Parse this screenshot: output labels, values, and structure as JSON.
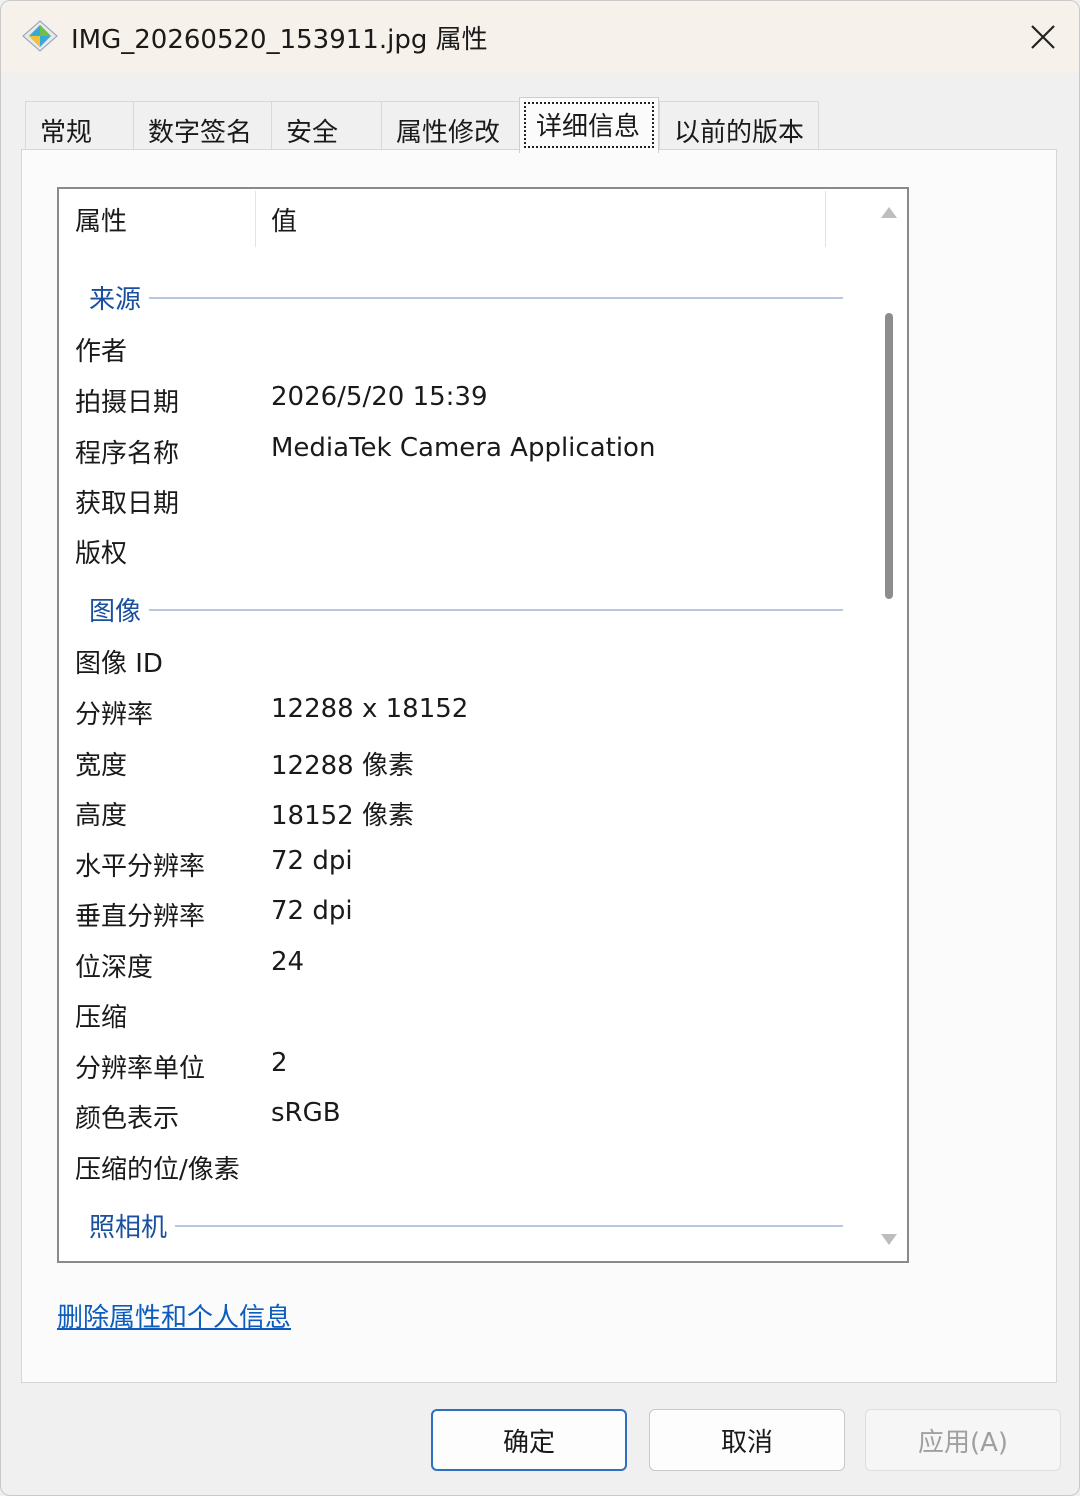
{
  "window": {
    "title": "IMG_20260520_153911.jpg 属性"
  },
  "tabs": [
    {
      "label": "常规"
    },
    {
      "label": "数字签名"
    },
    {
      "label": "安全"
    },
    {
      "label": "属性修改"
    },
    {
      "label": "详细信息"
    },
    {
      "label": "以前的版本"
    }
  ],
  "active_tab": "详细信息",
  "list": {
    "header": {
      "property": "属性",
      "value": "值"
    },
    "groups": {
      "source": {
        "label": "来源",
        "rows": [
          {
            "k": "作者",
            "v": ""
          },
          {
            "k": "拍摄日期",
            "v": "2026/5/20 15:39"
          },
          {
            "k": "程序名称",
            "v": "MediaTek Camera Application"
          },
          {
            "k": "获取日期",
            "v": ""
          },
          {
            "k": "版权",
            "v": ""
          }
        ]
      },
      "image": {
        "label": "图像",
        "rows": [
          {
            "k": "图像 ID",
            "v": ""
          },
          {
            "k": "分辨率",
            "v": "12288 x 18152"
          },
          {
            "k": "宽度",
            "v": "12288 像素"
          },
          {
            "k": "高度",
            "v": "18152 像素"
          },
          {
            "k": "水平分辨率",
            "v": "72 dpi"
          },
          {
            "k": "垂直分辨率",
            "v": "72 dpi"
          },
          {
            "k": "位深度",
            "v": "24"
          },
          {
            "k": "压缩",
            "v": ""
          },
          {
            "k": "分辨率单位",
            "v": "2"
          },
          {
            "k": "颜色表示",
            "v": "sRGB"
          },
          {
            "k": "压缩的位/像素",
            "v": ""
          }
        ]
      },
      "camera": {
        "label": "照相机"
      }
    }
  },
  "link": {
    "label": "删除属性和个人信息"
  },
  "buttons": {
    "ok": "确定",
    "cancel": "取消",
    "apply": "应用(A)"
  }
}
